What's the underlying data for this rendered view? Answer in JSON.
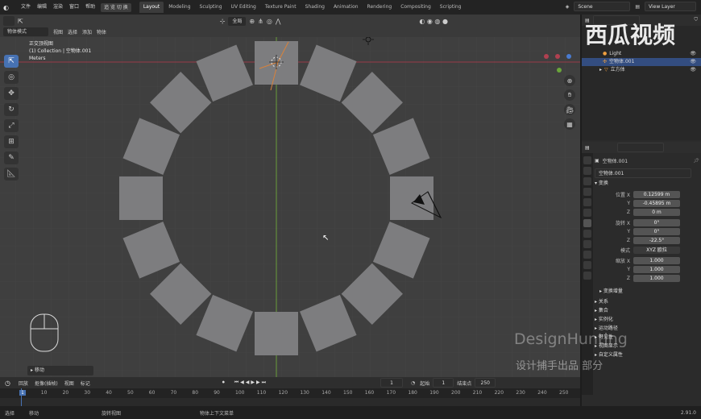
{
  "menu": [
    "文件",
    "编辑",
    "渲染",
    "窗口",
    "帮助"
  ],
  "workspace_switch": "追 览 切 换",
  "workspaces": [
    "Layout",
    "Modeling",
    "Sculpting",
    "UV Editing",
    "Texture Paint",
    "Shading",
    "Animation",
    "Rendering",
    "Compositing",
    "Scripting"
  ],
  "active_workspace": "Layout",
  "scene": "Scene",
  "view_layer": "View Layer",
  "viewport": {
    "mode": "物体模式",
    "menus": [
      "视图",
      "选择",
      "添加",
      "物体"
    ],
    "transform_orient": "全局",
    "overlay_title": "正交顶视图",
    "overlay_collection": "(1) Collection | 空物体.001",
    "overlay_units": "Meters",
    "operator_panel": "▸ 移动",
    "cursor": "↖"
  },
  "outliner": {
    "rows": [
      {
        "label": "Light",
        "selected": false
      },
      {
        "label": "空物体.001",
        "selected": true
      },
      {
        "label": "立方体",
        "selected": false
      }
    ]
  },
  "properties": {
    "object_name": "空物体.001",
    "data_name": "空物体.001",
    "section_transform": "变换",
    "location": {
      "label": "位置 X",
      "x": "0.12599 m",
      "y": "-0.45895 m",
      "z": "0 m"
    },
    "rotation": {
      "label": "旋转 X",
      "x": "0°",
      "y": "0°",
      "z": "-22.5°"
    },
    "mode_label": "模式",
    "mode_value": "XYZ 欧拉",
    "scale": {
      "label": "缩放 X",
      "x": "1.000",
      "y": "1.000",
      "z": "1.000"
    },
    "axis_y": "Y",
    "axis_z": "Z",
    "delta": "变换增量",
    "sections": [
      "关系",
      "集合",
      "实例化",
      "运动路径",
      "可见性",
      "视图显示",
      "自定义属性"
    ]
  },
  "timeline": {
    "menus": [
      "回放",
      "抠像(插帧)",
      "视图",
      "标记"
    ],
    "current_frame": "1",
    "start_label": "起始",
    "start": "1",
    "end_label": "结束点",
    "end": "250",
    "ticks": [
      "1",
      "10",
      "20",
      "30",
      "40",
      "50",
      "60",
      "70",
      "80",
      "90",
      "100",
      "110",
      "120",
      "130",
      "140",
      "150",
      "160",
      "170",
      "180",
      "190",
      "200",
      "210",
      "220",
      "230",
      "240",
      "250"
    ]
  },
  "status": [
    "选择",
    "移动",
    "旋转视图",
    "物体上下文菜单"
  ],
  "version": "2.91.0",
  "watermarks": {
    "brand": "西瓜视频",
    "design": "DesignHunting",
    "cn": "设计捕手出品 部分"
  },
  "colors": {
    "accent": "#4772b3",
    "viewport_bg": "#3f3f3f",
    "tile": "#7d7d7f",
    "x_axis": "#9a3b48",
    "y_axis": "#6a9e3a"
  }
}
